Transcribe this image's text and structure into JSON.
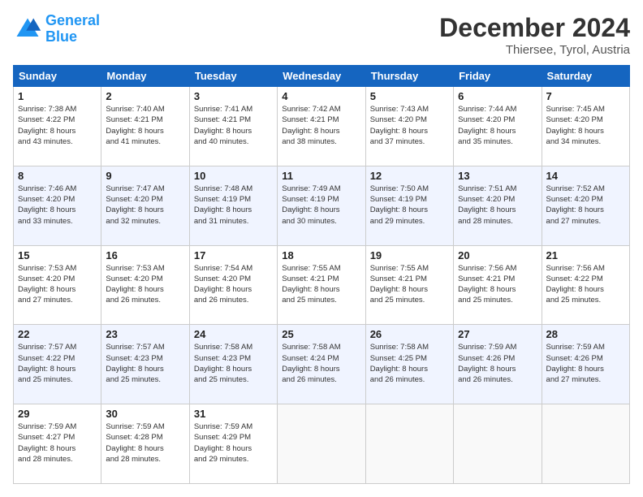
{
  "header": {
    "logo_line1": "General",
    "logo_line2": "Blue",
    "month": "December 2024",
    "location": "Thiersee, Tyrol, Austria"
  },
  "weekdays": [
    "Sunday",
    "Monday",
    "Tuesday",
    "Wednesday",
    "Thursday",
    "Friday",
    "Saturday"
  ],
  "weeks": [
    [
      {
        "day": "1",
        "info": "Sunrise: 7:38 AM\nSunset: 4:22 PM\nDaylight: 8 hours\nand 43 minutes."
      },
      {
        "day": "2",
        "info": "Sunrise: 7:40 AM\nSunset: 4:21 PM\nDaylight: 8 hours\nand 41 minutes."
      },
      {
        "day": "3",
        "info": "Sunrise: 7:41 AM\nSunset: 4:21 PM\nDaylight: 8 hours\nand 40 minutes."
      },
      {
        "day": "4",
        "info": "Sunrise: 7:42 AM\nSunset: 4:21 PM\nDaylight: 8 hours\nand 38 minutes."
      },
      {
        "day": "5",
        "info": "Sunrise: 7:43 AM\nSunset: 4:20 PM\nDaylight: 8 hours\nand 37 minutes."
      },
      {
        "day": "6",
        "info": "Sunrise: 7:44 AM\nSunset: 4:20 PM\nDaylight: 8 hours\nand 35 minutes."
      },
      {
        "day": "7",
        "info": "Sunrise: 7:45 AM\nSunset: 4:20 PM\nDaylight: 8 hours\nand 34 minutes."
      }
    ],
    [
      {
        "day": "8",
        "info": "Sunrise: 7:46 AM\nSunset: 4:20 PM\nDaylight: 8 hours\nand 33 minutes."
      },
      {
        "day": "9",
        "info": "Sunrise: 7:47 AM\nSunset: 4:20 PM\nDaylight: 8 hours\nand 32 minutes."
      },
      {
        "day": "10",
        "info": "Sunrise: 7:48 AM\nSunset: 4:19 PM\nDaylight: 8 hours\nand 31 minutes."
      },
      {
        "day": "11",
        "info": "Sunrise: 7:49 AM\nSunset: 4:19 PM\nDaylight: 8 hours\nand 30 minutes."
      },
      {
        "day": "12",
        "info": "Sunrise: 7:50 AM\nSunset: 4:19 PM\nDaylight: 8 hours\nand 29 minutes."
      },
      {
        "day": "13",
        "info": "Sunrise: 7:51 AM\nSunset: 4:20 PM\nDaylight: 8 hours\nand 28 minutes."
      },
      {
        "day": "14",
        "info": "Sunrise: 7:52 AM\nSunset: 4:20 PM\nDaylight: 8 hours\nand 27 minutes."
      }
    ],
    [
      {
        "day": "15",
        "info": "Sunrise: 7:53 AM\nSunset: 4:20 PM\nDaylight: 8 hours\nand 27 minutes."
      },
      {
        "day": "16",
        "info": "Sunrise: 7:53 AM\nSunset: 4:20 PM\nDaylight: 8 hours\nand 26 minutes."
      },
      {
        "day": "17",
        "info": "Sunrise: 7:54 AM\nSunset: 4:20 PM\nDaylight: 8 hours\nand 26 minutes."
      },
      {
        "day": "18",
        "info": "Sunrise: 7:55 AM\nSunset: 4:21 PM\nDaylight: 8 hours\nand 25 minutes."
      },
      {
        "day": "19",
        "info": "Sunrise: 7:55 AM\nSunset: 4:21 PM\nDaylight: 8 hours\nand 25 minutes."
      },
      {
        "day": "20",
        "info": "Sunrise: 7:56 AM\nSunset: 4:21 PM\nDaylight: 8 hours\nand 25 minutes."
      },
      {
        "day": "21",
        "info": "Sunrise: 7:56 AM\nSunset: 4:22 PM\nDaylight: 8 hours\nand 25 minutes."
      }
    ],
    [
      {
        "day": "22",
        "info": "Sunrise: 7:57 AM\nSunset: 4:22 PM\nDaylight: 8 hours\nand 25 minutes."
      },
      {
        "day": "23",
        "info": "Sunrise: 7:57 AM\nSunset: 4:23 PM\nDaylight: 8 hours\nand 25 minutes."
      },
      {
        "day": "24",
        "info": "Sunrise: 7:58 AM\nSunset: 4:23 PM\nDaylight: 8 hours\nand 25 minutes."
      },
      {
        "day": "25",
        "info": "Sunrise: 7:58 AM\nSunset: 4:24 PM\nDaylight: 8 hours\nand 26 minutes."
      },
      {
        "day": "26",
        "info": "Sunrise: 7:58 AM\nSunset: 4:25 PM\nDaylight: 8 hours\nand 26 minutes."
      },
      {
        "day": "27",
        "info": "Sunrise: 7:59 AM\nSunset: 4:26 PM\nDaylight: 8 hours\nand 26 minutes."
      },
      {
        "day": "28",
        "info": "Sunrise: 7:59 AM\nSunset: 4:26 PM\nDaylight: 8 hours\nand 27 minutes."
      }
    ],
    [
      {
        "day": "29",
        "info": "Sunrise: 7:59 AM\nSunset: 4:27 PM\nDaylight: 8 hours\nand 28 minutes."
      },
      {
        "day": "30",
        "info": "Sunrise: 7:59 AM\nSunset: 4:28 PM\nDaylight: 8 hours\nand 28 minutes."
      },
      {
        "day": "31",
        "info": "Sunrise: 7:59 AM\nSunset: 4:29 PM\nDaylight: 8 hours\nand 29 minutes."
      },
      null,
      null,
      null,
      null
    ]
  ]
}
